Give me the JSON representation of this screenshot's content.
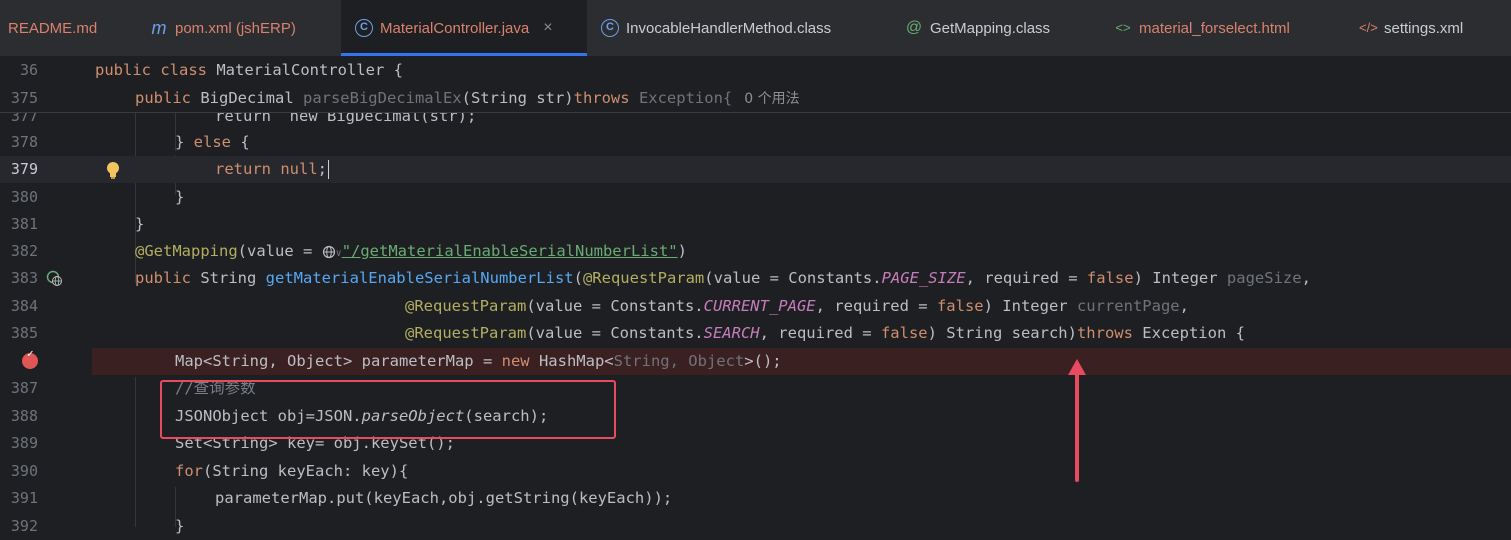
{
  "tabs": [
    {
      "label": "README.md",
      "icon": "markdown-icon",
      "color": "#d9826d"
    },
    {
      "label": "pom.xml (jshERP)",
      "icon": "maven-icon",
      "color": "#d9826d"
    },
    {
      "label": "MaterialController.java",
      "icon": "class-icon",
      "color": "#d9826d",
      "active": true,
      "close": "×"
    },
    {
      "label": "InvocableHandlerMethod.class",
      "icon": "class-icon",
      "color": "#c9ccd2"
    },
    {
      "label": "GetMapping.class",
      "icon": "annotation-icon",
      "color": "#c9ccd2"
    },
    {
      "label": "material_forselect.html",
      "icon": "html-icon",
      "color": "#d9826d"
    },
    {
      "label": "settings.xml",
      "icon": "xml-icon",
      "color": "#c9ccd2"
    }
  ],
  "sticky": [
    {
      "ln": "36",
      "kw": "public class ",
      "name": "MaterialController {"
    },
    {
      "ln": "375",
      "kw": "public ",
      "type": "BigDecimal ",
      "method": "parseBigDecimalEx",
      "params": "(String str)",
      "throws": "throws",
      "exc": " Exception{",
      "hint": "0 个用法"
    }
  ],
  "lines": {
    "l377": {
      "ln": "377",
      "text": "return  new BigDecimal(str);"
    },
    "l378": {
      "ln": "378",
      "close": "} ",
      "else": "else",
      "brace": " {"
    },
    "l379": {
      "ln": "379",
      "ret": "return ",
      "nul": "null",
      "semi": ";"
    },
    "l380": {
      "ln": "380",
      "text": "}"
    },
    "l381": {
      "ln": "381",
      "text": "}"
    },
    "l382": {
      "ln": "382",
      "ann": "@GetMapping",
      "p1": "(value = ",
      "path": "\"/getMaterialEnableSerialNumberList\"",
      "p2": ")"
    },
    "l383": {
      "ln": "383",
      "kw": "public ",
      "type": "String ",
      "method": "getMaterialEnableSerialNumberList",
      "open": "(",
      "ann": "@RequestParam",
      "a1": "(value = Constants.",
      "cst": "PAGE_SIZE",
      "a2": ", required = ",
      "fal": "false",
      "a3": ") Integer ",
      "pname": "pageSize",
      "a4": ","
    },
    "l384": {
      "ln": "384",
      "ann": "@RequestParam",
      "a1": "(value = Constants.",
      "cst": "CURRENT_PAGE",
      "a2": ", required = ",
      "fal": "false",
      "a3": ") Integer ",
      "pname": "currentPage",
      "a4": ","
    },
    "l385": {
      "ln": "385",
      "ann": "@RequestParam",
      "a1": "(value = Constants.",
      "cst": "SEARCH",
      "a2": ", required = ",
      "fal": "false",
      "a3": ") String search)",
      "thr": "throws",
      "a4": " Exception {"
    },
    "l386": {
      "text1": "Map<String, Object> parameterMap = ",
      "nw": "new",
      "text2": " HashMap<",
      "dim": "String, Object",
      "text3": ">();"
    },
    "l387": {
      "ln": "387",
      "cmt": "//查询参数"
    },
    "l388": {
      "ln": "388",
      "t1": "JSONObject obj=JSON.",
      "it": "parseObject",
      "t2": "(search);"
    },
    "l389": {
      "ln": "389",
      "text": "Set<String> key= obj.keySet();"
    },
    "l390": {
      "ln": "390",
      "kw": "for",
      "text": "(String keyEach: key){"
    },
    "l391": {
      "ln": "391",
      "text": "parameterMap.put(keyEach,obj.getString(keyEach));"
    },
    "l392": {
      "ln": "392",
      "text": "}"
    }
  }
}
